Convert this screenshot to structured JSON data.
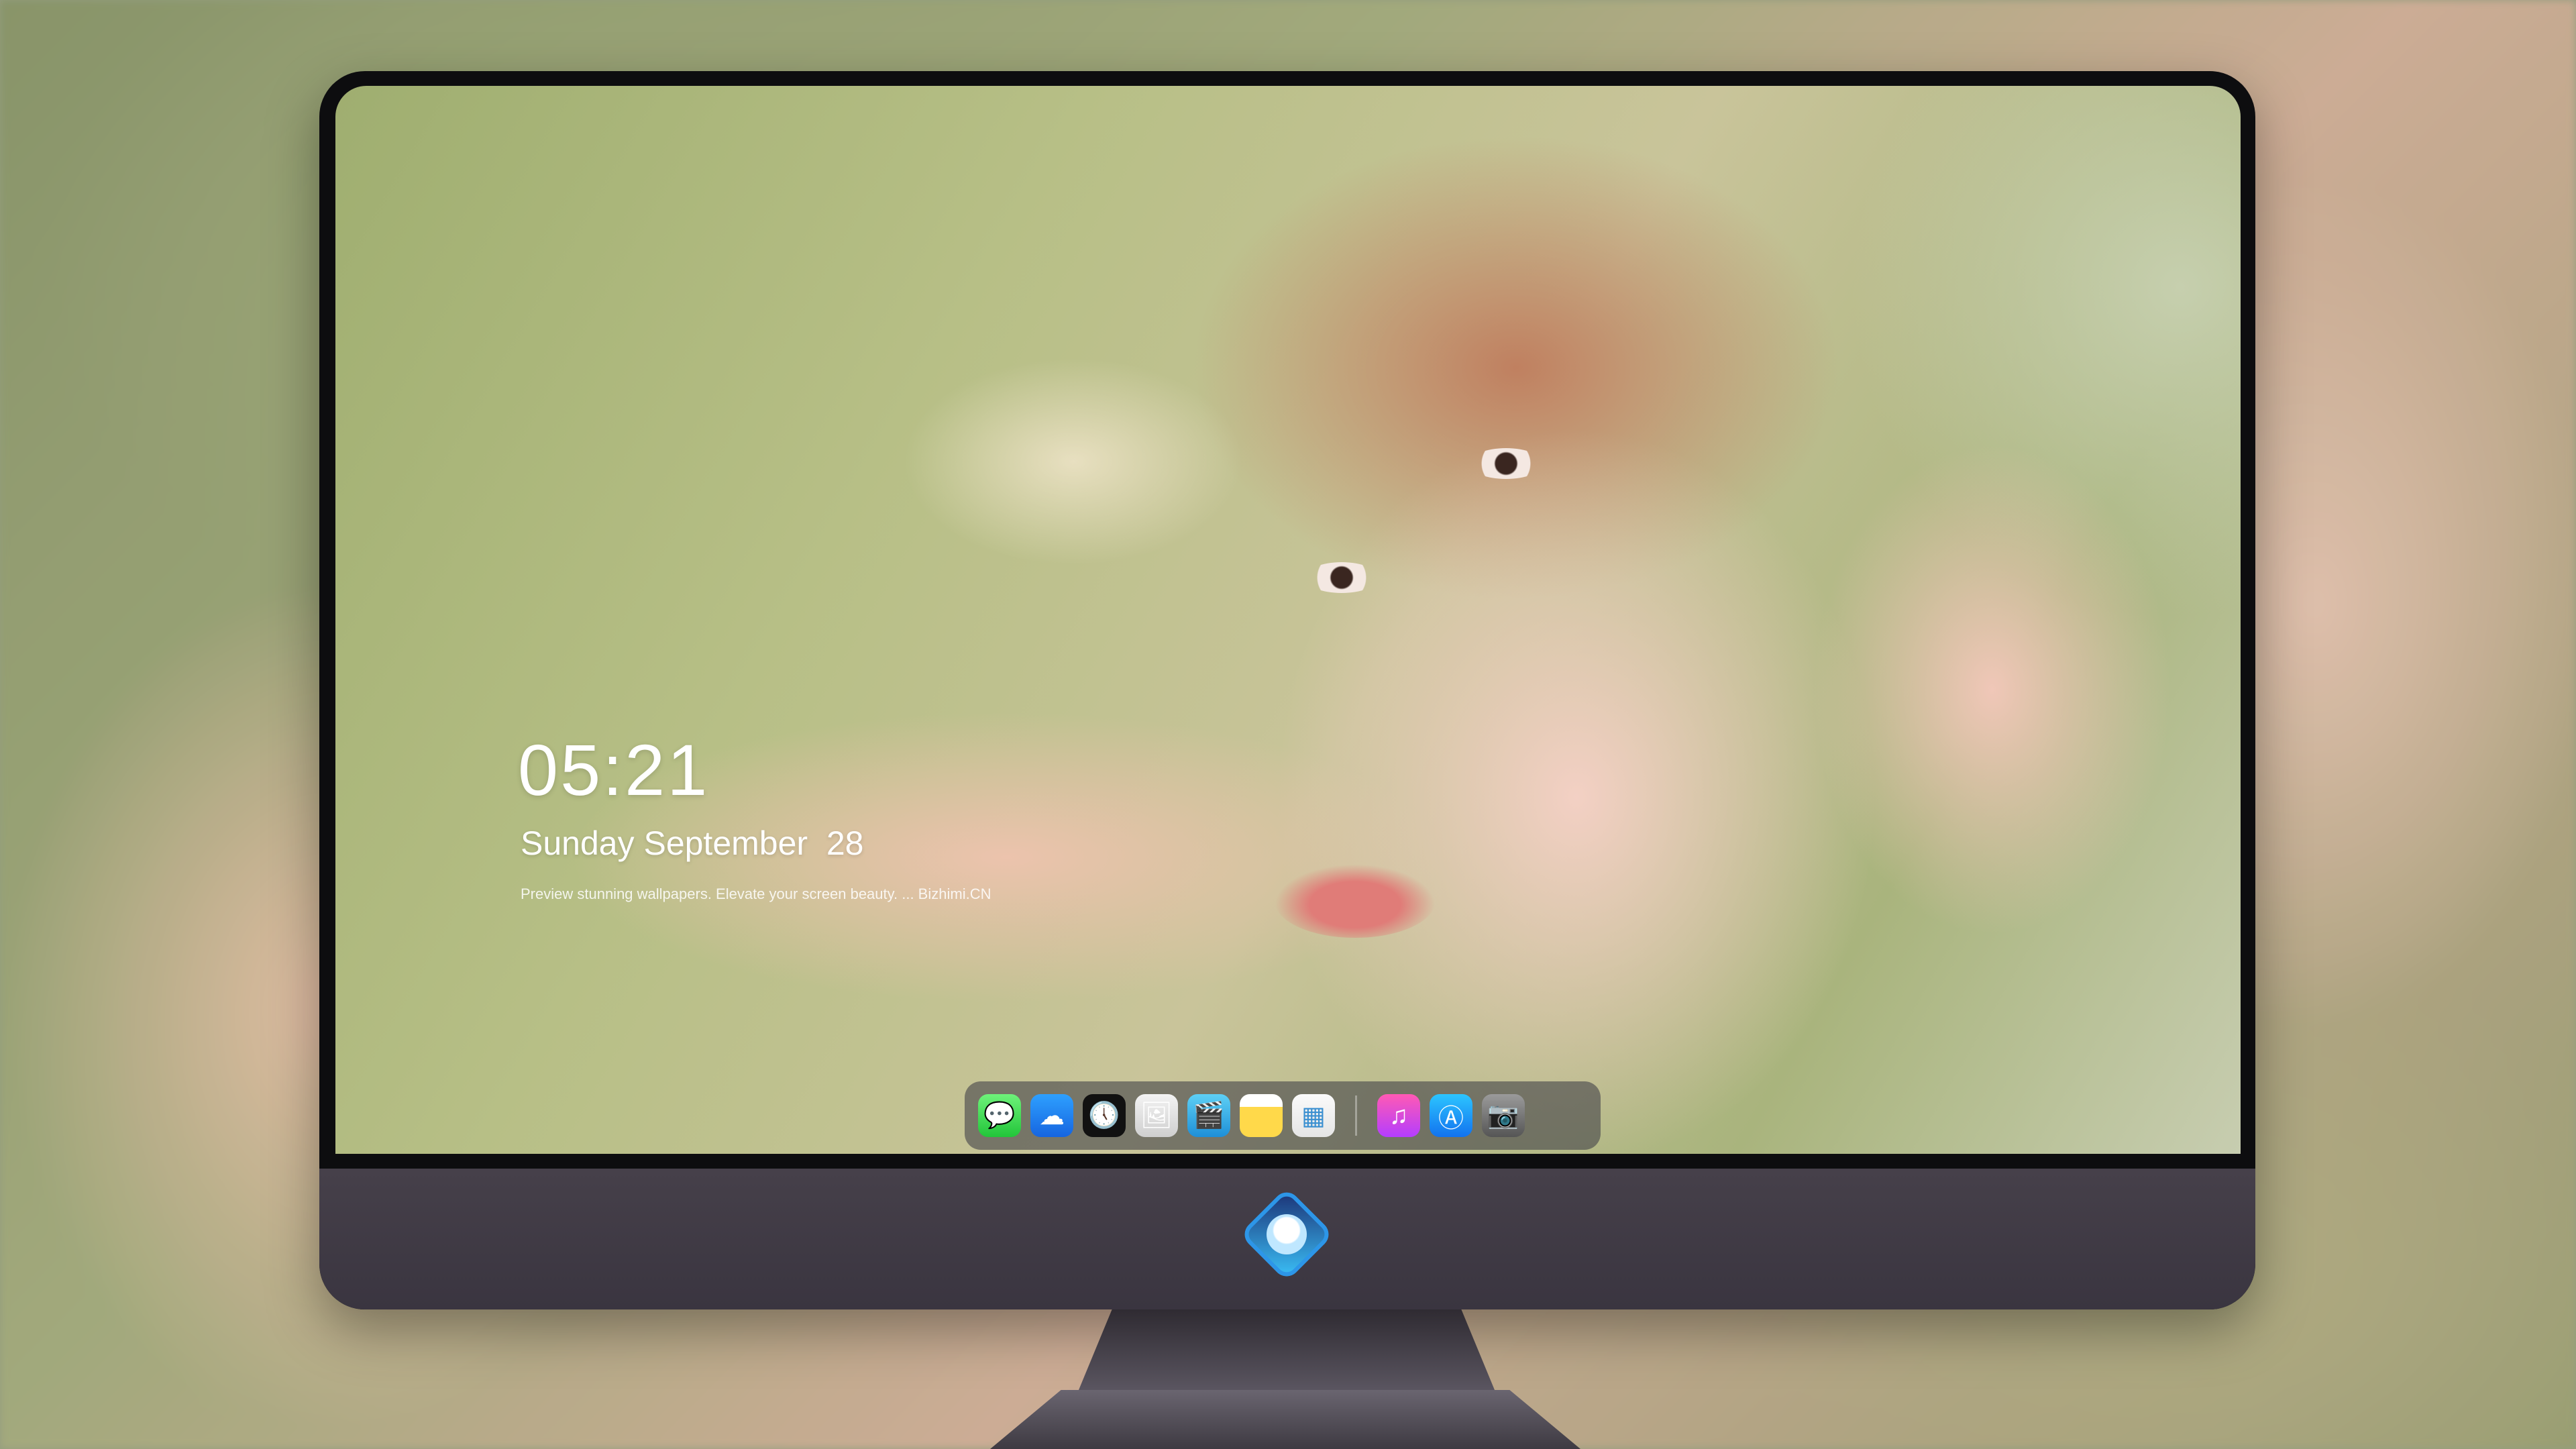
{
  "lock_screen": {
    "time": "05:21",
    "date": "Sunday September  28",
    "tagline": "Preview stunning wallpapers. Elevate your screen beauty. ... Bizhimi.CN"
  },
  "dock": {
    "apps": [
      {
        "name": "messages-icon",
        "glyph": "💬"
      },
      {
        "name": "weather-icon",
        "glyph": "☁"
      },
      {
        "name": "clock-icon",
        "glyph": "🕔"
      },
      {
        "name": "preview-icon",
        "glyph": "🖼"
      },
      {
        "name": "claquette-icon",
        "glyph": "🎬"
      },
      {
        "name": "notes-icon",
        "glyph": ""
      },
      {
        "name": "photos-icon",
        "glyph": "▦"
      }
    ],
    "recent_apps": [
      {
        "name": "itunes-icon",
        "glyph": "♫"
      },
      {
        "name": "app-store-icon",
        "glyph": "Ⓐ"
      },
      {
        "name": "camera-icon",
        "glyph": "📷"
      }
    ]
  },
  "colors": {
    "monitor_bezel": "#0d0d0f",
    "chin": "#46404a",
    "dock_bg": "rgba(70,70,75,0.62)"
  }
}
